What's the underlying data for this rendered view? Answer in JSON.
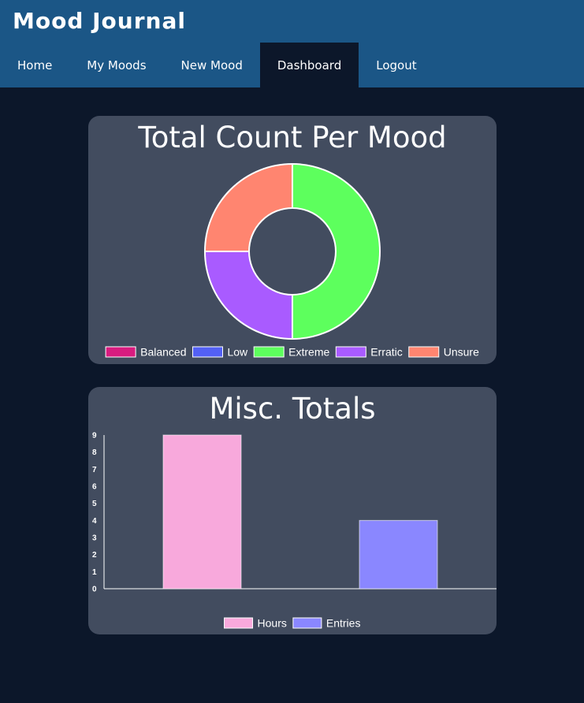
{
  "app": {
    "title": "Mood Journal"
  },
  "nav": [
    {
      "label": "Home",
      "active": false
    },
    {
      "label": "My Moods",
      "active": false
    },
    {
      "label": "New Mood",
      "active": false
    },
    {
      "label": "Dashboard",
      "active": true
    },
    {
      "label": "Logout",
      "active": false
    }
  ],
  "colors": {
    "header": "#1b5686",
    "page_bg": "#0c172a",
    "card_bg": "#424c5f"
  },
  "chart_data": [
    {
      "type": "pie",
      "variant": "doughnut",
      "title": "Total Count Per Mood",
      "legend_position": "bottom",
      "categories": [
        "Balanced",
        "Low",
        "Extreme",
        "Erratic",
        "Unsure"
      ],
      "values": [
        0,
        0,
        2,
        1,
        1
      ],
      "colors": [
        "#d81b7f",
        "#5360f4",
        "#5dff5d",
        "#a95bff",
        "#ff8570"
      ]
    },
    {
      "type": "bar",
      "title": "Misc. Totals",
      "legend_position": "bottom",
      "series": [
        {
          "name": "Hours",
          "values": [
            9
          ],
          "color": "#f8a9dc"
        },
        {
          "name": "Entries",
          "values": [
            4
          ],
          "color": "#8a87ff"
        }
      ],
      "ylim": [
        0,
        9
      ],
      "yticks": [
        "0",
        "1",
        "2",
        "3",
        "4",
        "5",
        "6",
        "7",
        "8",
        "9"
      ]
    }
  ]
}
